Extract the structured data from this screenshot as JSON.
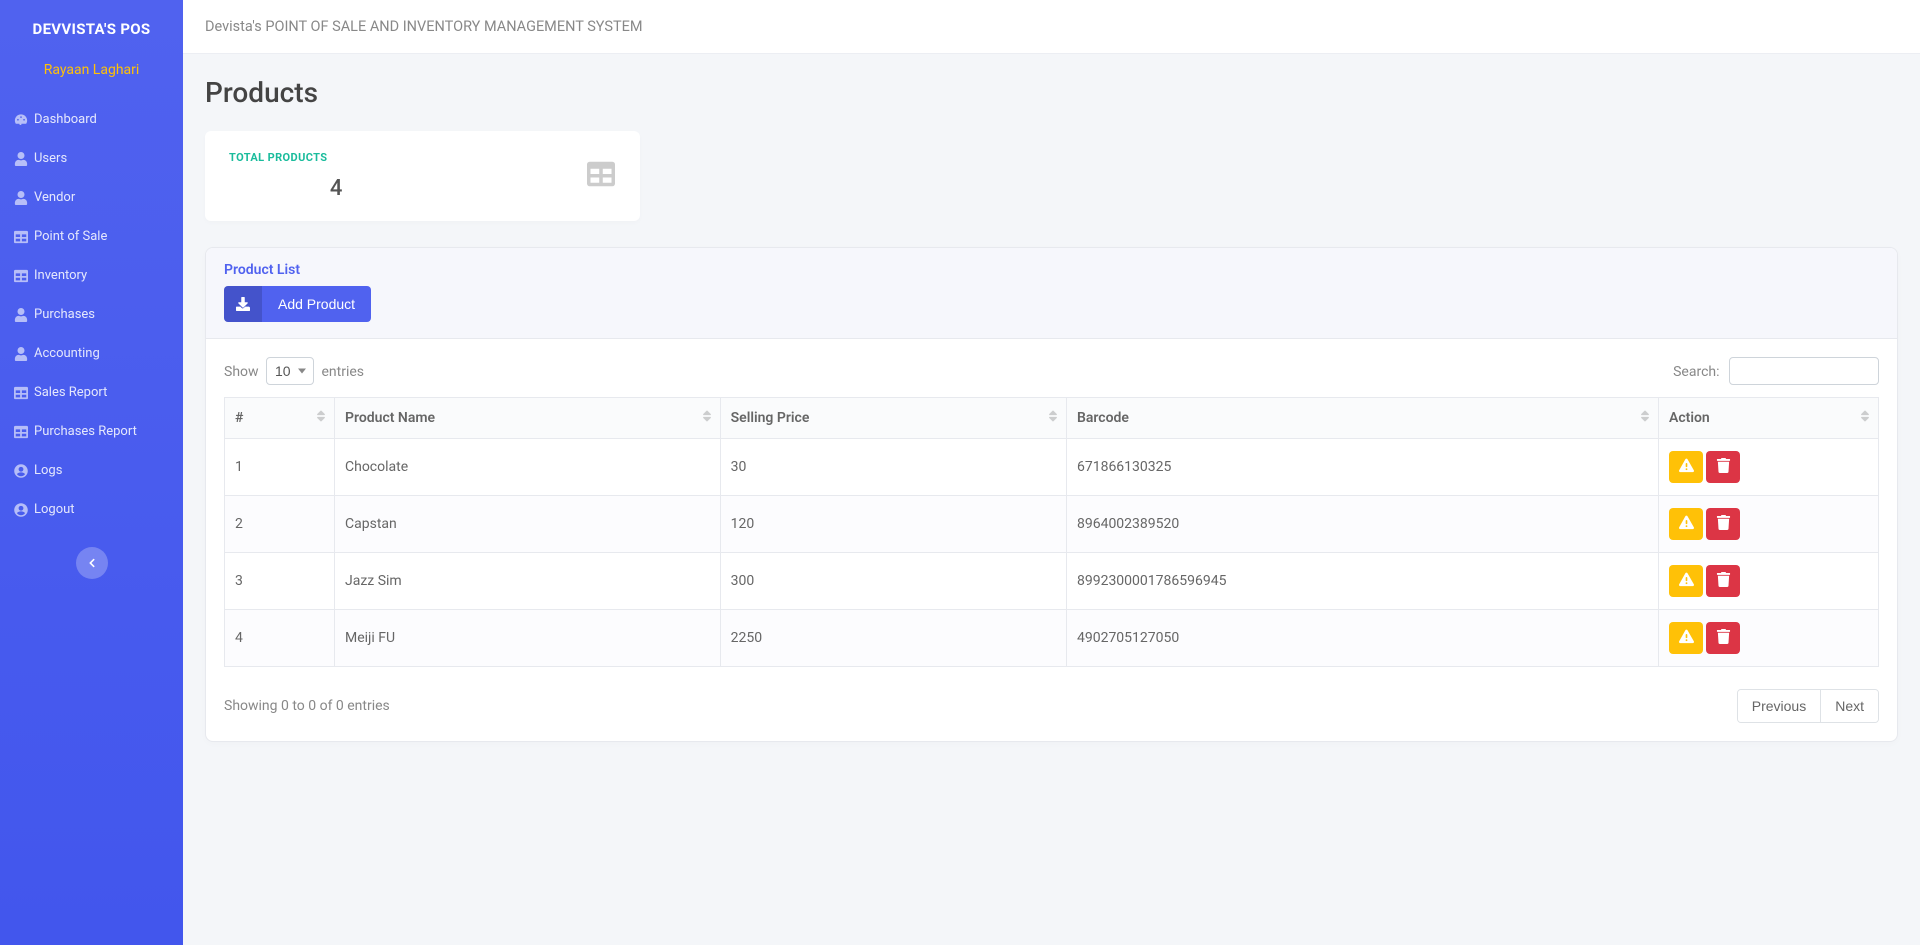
{
  "brand": "DEVVISTA'S POS",
  "user_name": "Rayaan Laghari",
  "top_title": "Devista's POINT OF SALE AND INVENTORY MANAGEMENT SYSTEM",
  "nav": {
    "dashboard": "Dashboard",
    "users": "Users",
    "vendor": "Vendor",
    "pos": "Point of Sale",
    "inventory": "Inventory",
    "purchases": "Purchases",
    "accounting": "Accounting",
    "sales_report": "Sales Report",
    "purchases_report": "Purchases Report",
    "logs": "Logs",
    "logout": "Logout"
  },
  "page_title": "Products",
  "stat": {
    "label": "TOTAL PRODUCTS",
    "value": "4"
  },
  "list": {
    "title": "Product List",
    "add_label": "Add Product",
    "show_label_pre": "Show",
    "show_label_post": "entries",
    "page_size": "10",
    "search_label": "Search:",
    "columns": {
      "idx": "#",
      "name": "Product Name",
      "price": "Selling Price",
      "barcode": "Barcode",
      "action": "Action"
    },
    "rows": [
      {
        "idx": "1",
        "name": "Chocolate",
        "price": "30",
        "barcode": "671866130325"
      },
      {
        "idx": "2",
        "name": "Capstan",
        "price": "120",
        "barcode": "8964002389520"
      },
      {
        "idx": "3",
        "name": "Jazz Sim",
        "price": "300",
        "barcode": "8992300001786596945"
      },
      {
        "idx": "4",
        "name": "Meiji FU",
        "price": "2250",
        "barcode": "4902705127050"
      }
    ],
    "info": "Showing 0 to 0 of 0 entries",
    "prev": "Previous",
    "next": "Next"
  }
}
